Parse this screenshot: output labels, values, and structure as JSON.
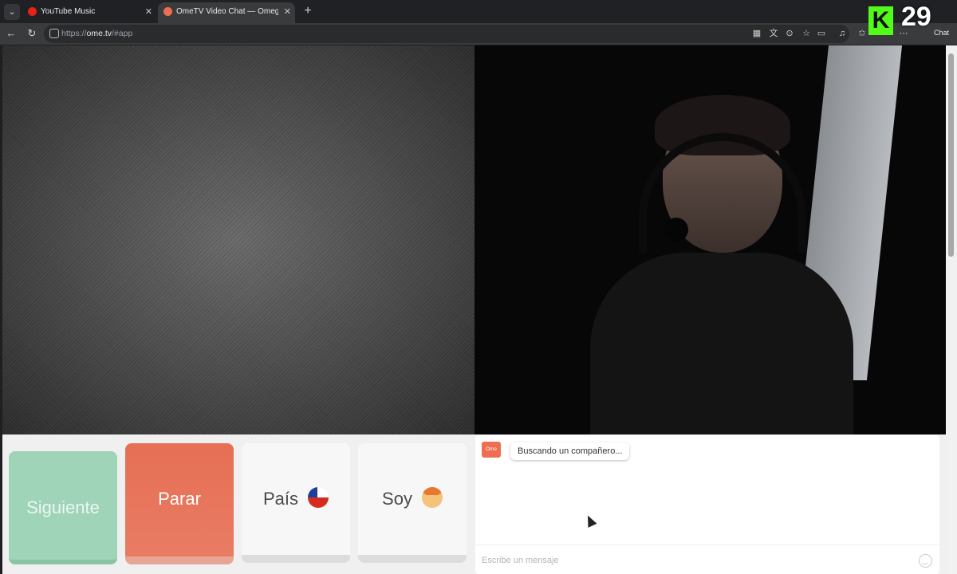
{
  "browser": {
    "tabs": [
      {
        "title": "YouTube Music",
        "close": "✕",
        "icon": "youtube-music-icon",
        "color": "#e62117"
      },
      {
        "title": "OmeTV Video Chat — Omegle",
        "close": "✕",
        "icon": "ometv-icon",
        "color": "#ef6e52"
      }
    ],
    "new_tab": "+",
    "url_prefix": "https://",
    "url_host": "ome.tv",
    "url_path": "/#app"
  },
  "overlay": {
    "kick_logo": "K",
    "viewer_count": "29",
    "chat_label": "Chat",
    "kick_color": "#53fc18"
  },
  "controls": {
    "next_label": "Siguiente",
    "stop_label": "Parar",
    "country_label": "País",
    "country_flag": "chile-flag-icon",
    "gender_label": "Soy",
    "gender_icon": "boy-icon"
  },
  "chat": {
    "logo_text": "Ome TV",
    "status_message": "Buscando un compañero...",
    "input_placeholder": "Escribe un mensaje"
  },
  "colors": {
    "next": "#9fd4b9",
    "stop": "#e66f55",
    "accent": "#ef6e52"
  }
}
